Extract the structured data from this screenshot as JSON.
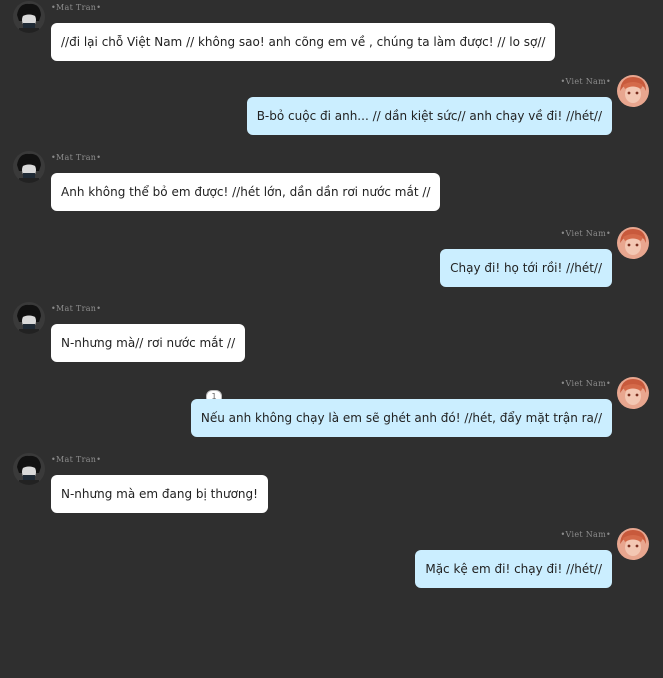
{
  "participants": {
    "left_name": "•Mat Tran•",
    "right_name": "•Viet Nam•"
  },
  "messages": [
    {
      "side": "left",
      "name": "•Mat Tran•",
      "text": "//đi lại chỗ Việt Nam // không sao! anh cõng em về , chúng ta làm được! // lo sợ//"
    },
    {
      "side": "right",
      "name": "•Viet Nam•",
      "text": "B-bỏ cuộc đi anh... // dần kiệt sức// anh chạy về đi! //hét//"
    },
    {
      "side": "left",
      "name": "•Mat Tran•",
      "text": "Anh không thể bỏ em được! //hét lớn, dần dần rơi nước mắt //"
    },
    {
      "side": "right",
      "name": "•Viet Nam•",
      "text": "Chạy đi! họ tới rồi! //hét//"
    },
    {
      "side": "left",
      "name": "•Mat Tran•",
      "text": "N-nhưng mà// rơi nước mắt //"
    },
    {
      "side": "right",
      "name": "•Viet Nam•",
      "text": "Nếu anh không chạy là em sẽ ghét anh đó! //hét, đẩy mặt trận ra//",
      "badge": "1"
    },
    {
      "side": "left",
      "name": "•Mat Tran•",
      "text": "N-nhưng mà em đang bị thương!"
    },
    {
      "side": "right",
      "name": "•Viet Nam•",
      "text": "Mặc kệ em đi! chạy đi! //hét//"
    }
  ],
  "colors": {
    "background": "#2f2f2f",
    "left_bubble": "#ffffff",
    "right_bubble": "#cbeeff"
  }
}
